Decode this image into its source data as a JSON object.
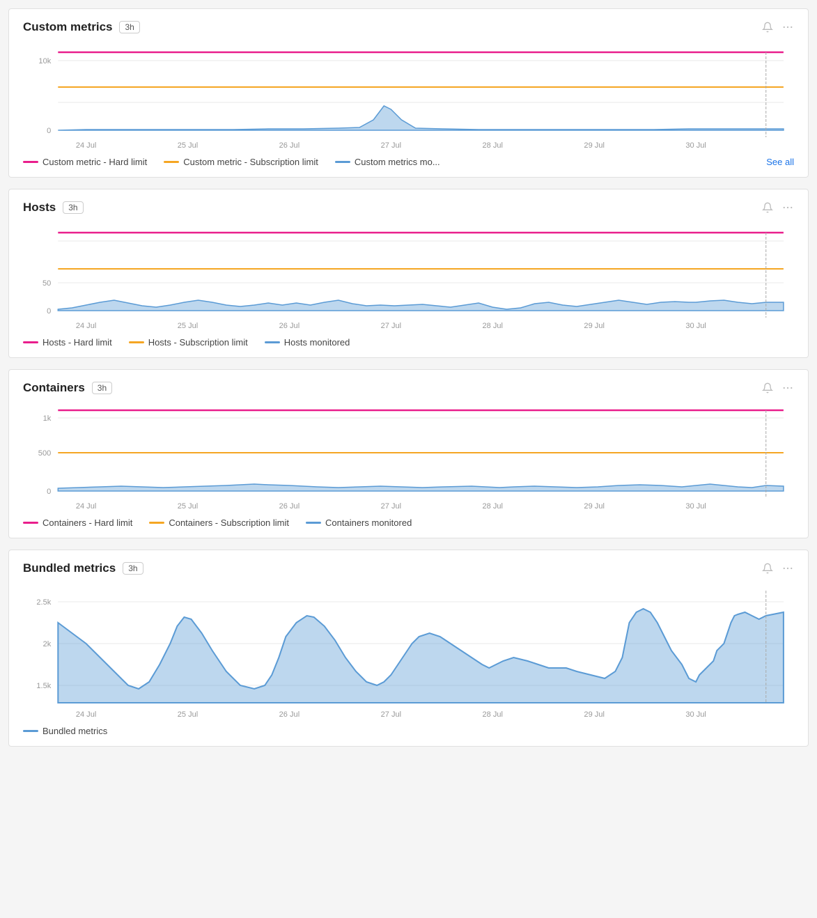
{
  "panels": [
    {
      "id": "custom-metrics",
      "title": "Custom metrics",
      "time_badge": "3h",
      "see_all": "See all",
      "legend": [
        {
          "label": "Custom metric - Hard limit",
          "color": "#e91e8c",
          "type": "solid"
        },
        {
          "label": "Custom metric - Subscription limit",
          "color": "#f5a623",
          "type": "solid"
        },
        {
          "label": "Custom metrics mo...",
          "color": "#5b9bd5",
          "type": "solid"
        }
      ],
      "y_labels": [
        "10k",
        "0"
      ],
      "x_labels": [
        "24 Jul",
        "25 Jul",
        "26 Jul",
        "27 Jul",
        "28 Jul",
        "29 Jul",
        "30 Jul"
      ],
      "has_see_all": true
    },
    {
      "id": "hosts",
      "title": "Hosts",
      "time_badge": "3h",
      "legend": [
        {
          "label": "Hosts - Hard limit",
          "color": "#e91e8c",
          "type": "solid"
        },
        {
          "label": "Hosts - Subscription limit",
          "color": "#f5a623",
          "type": "solid"
        },
        {
          "label": "Hosts monitored",
          "color": "#5b9bd5",
          "type": "solid"
        }
      ],
      "y_labels": [
        "50",
        "0"
      ],
      "x_labels": [
        "24 Jul",
        "25 Jul",
        "26 Jul",
        "27 Jul",
        "28 Jul",
        "29 Jul",
        "30 Jul"
      ],
      "has_see_all": false
    },
    {
      "id": "containers",
      "title": "Containers",
      "time_badge": "3h",
      "legend": [
        {
          "label": "Containers - Hard limit",
          "color": "#e91e8c",
          "type": "solid"
        },
        {
          "label": "Containers - Subscription limit",
          "color": "#f5a623",
          "type": "solid"
        },
        {
          "label": "Containers monitored",
          "color": "#5b9bd5",
          "type": "solid"
        }
      ],
      "y_labels": [
        "1k",
        "500",
        "0"
      ],
      "x_labels": [
        "24 Jul",
        "25 Jul",
        "26 Jul",
        "27 Jul",
        "28 Jul",
        "29 Jul",
        "30 Jul"
      ],
      "has_see_all": false
    },
    {
      "id": "bundled-metrics",
      "title": "Bundled metrics",
      "time_badge": "3h",
      "legend": [
        {
          "label": "Bundled metrics",
          "color": "#5b9bd5",
          "type": "solid"
        }
      ],
      "y_labels": [
        "2.5k",
        "2k",
        "1.5k"
      ],
      "x_labels": [
        "24 Jul",
        "25 Jul",
        "26 Jul",
        "27 Jul",
        "28 Jul",
        "29 Jul",
        "30 Jul"
      ],
      "has_see_all": false
    }
  ],
  "icons": {
    "bell": "🔔",
    "more": "···"
  }
}
